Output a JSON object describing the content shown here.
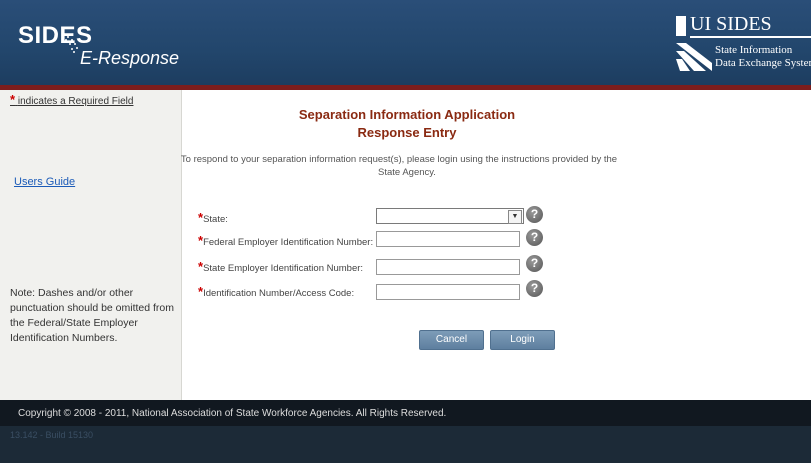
{
  "header": {
    "logo_sides": "SIDES",
    "logo_eresponse": "E-Response",
    "ui_sides_title": "UI SIDES",
    "ui_sides_sub1": "State Information",
    "ui_sides_sub2": "Data Exchange System"
  },
  "sidebar": {
    "required_note": "indicates a Required Field",
    "required_star": "*",
    "users_guide": "Users Guide",
    "note": "Note: Dashes and/or other punctuation should be omitted from the Federal/State Employer Identification Numbers."
  },
  "main": {
    "title_line1": "Separation Information Application",
    "title_line2": "Response Entry",
    "instructions_line1": "To respond to your separation information request(s), please login using the instructions provided by the",
    "instructions_line2": "State Agency.",
    "fields": [
      {
        "label": "State:",
        "value": "",
        "required": true
      },
      {
        "label": "Federal Employer Identification Number:",
        "value": "",
        "required": true
      },
      {
        "label": "State Employer Identification Number:",
        "value": "",
        "required": true
      },
      {
        "label": "Identification Number/Access Code:",
        "value": "",
        "required": true
      }
    ],
    "help_glyph": "?",
    "select_arrow": "▼",
    "cancel_label": "Cancel",
    "login_label": "Login"
  },
  "footer": {
    "copyright": "Copyright © 2008 - 2011, National Association of State Workforce Agencies. All Rights Reserved.",
    "build": "13.142 - Build 15130"
  },
  "colors": {
    "header_blue": "#22466c",
    "accent_red_line": "#7d1d1d",
    "title_color": "#8a2a12",
    "button_blue": "#6d8dae"
  }
}
